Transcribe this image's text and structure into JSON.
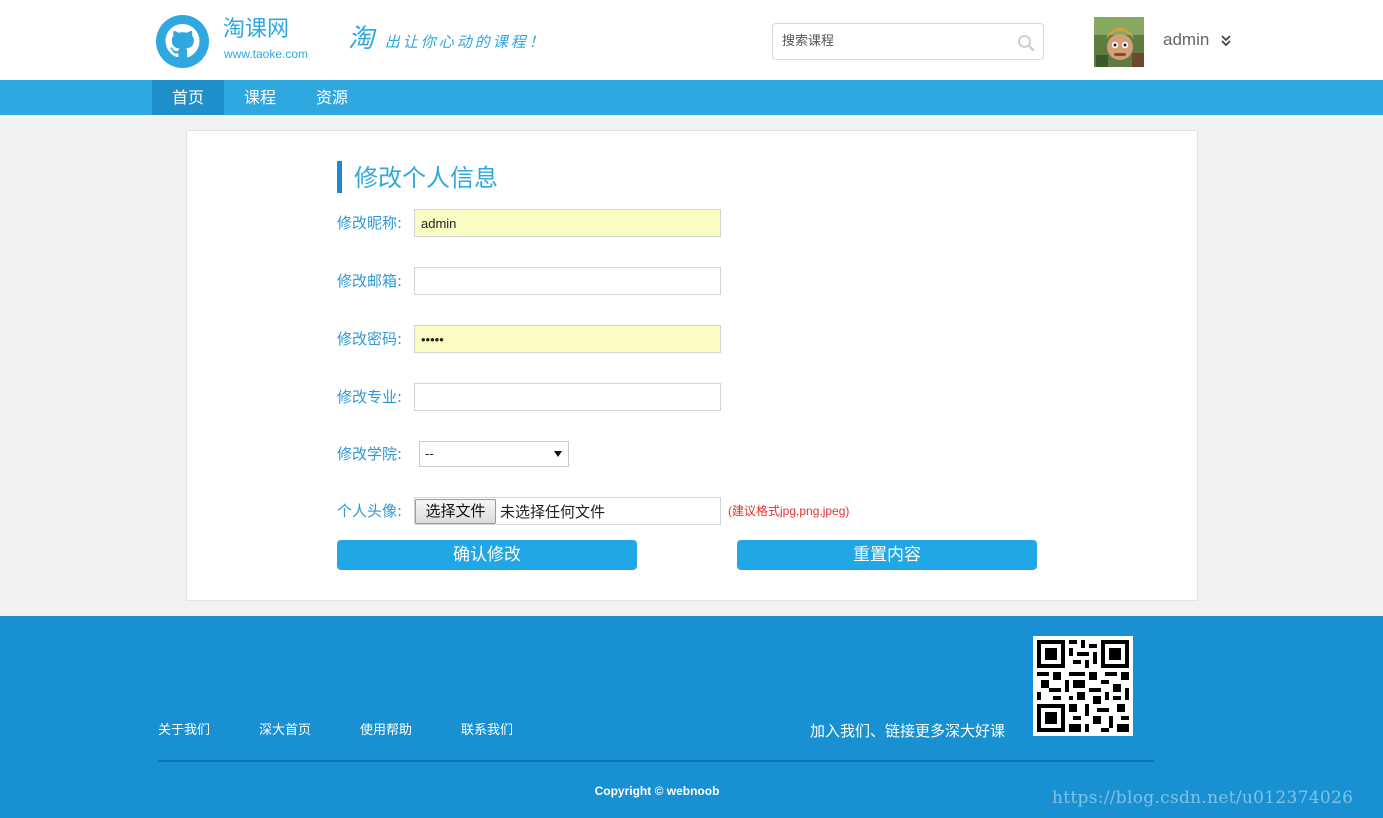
{
  "header": {
    "brand_name": "淘课网",
    "brand_url": "www.taoke.com",
    "slogan_char": "淘",
    "slogan_rest": "出让你心动的课程！",
    "search_placeholder": "搜索课程",
    "username": "admin"
  },
  "nav": {
    "items": [
      {
        "label": "首页",
        "active": true
      },
      {
        "label": "课程",
        "active": false
      },
      {
        "label": "资源",
        "active": false
      }
    ]
  },
  "form": {
    "title": "修改个人信息",
    "nickname_label": "修改昵称:",
    "nickname_value": "admin",
    "email_label": "修改邮箱:",
    "email_value": "",
    "password_label": "修改密码:",
    "password_value": "•••••",
    "major_label": "修改专业:",
    "major_value": "",
    "college_label": "修改学院:",
    "college_selected": "--",
    "avatar_label": "个人头像:",
    "file_button_label": "选择文件",
    "file_status": "未选择任何文件",
    "file_hint": "(建议格式jpg,png,jpeg)",
    "confirm_label": "确认修改",
    "reset_label": "重置内容"
  },
  "footer": {
    "links": [
      "关于我们",
      "深大首页",
      "使用帮助",
      "联系我们"
    ],
    "join_text": "加入我们、链接更多深大好课",
    "copyright": "Copyright © webnoob",
    "watermark": "https://blog.csdn.net/u012374026"
  },
  "colors": {
    "brand_blue": "#2fa8e0",
    "nav_active": "#1e8fc9",
    "button_blue": "#22a7e6",
    "footer_blue": "#1890d2",
    "autofill_yellow": "#fafcc4",
    "hint_red": "#e8302c"
  },
  "icons": {
    "logo": "github-octocat-icon",
    "search": "search-icon",
    "dropdown": "double-chevron-down-icon"
  }
}
